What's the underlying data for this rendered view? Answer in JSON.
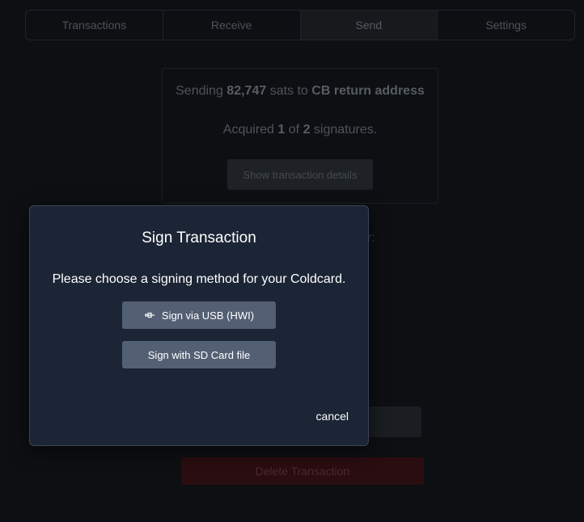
{
  "tabs": [
    {
      "label": "Transactions"
    },
    {
      "label": "Receive"
    },
    {
      "label": "Send"
    },
    {
      "label": "Settings"
    }
  ],
  "summary": {
    "sending_prefix": "Sending",
    "amount": "82,747",
    "sats_to": "sats to",
    "destination": "CB return address",
    "acquired_prefix": "Acquired",
    "acquired_count": "1",
    "of": "of",
    "required_count": "2",
    "signatures_suffix": "signatures.",
    "details_button": "Show transaction details"
  },
  "background": {
    "colon_fragment": "r:",
    "delete_button": "Delete Transaction"
  },
  "modal": {
    "title": "Sign Transaction",
    "description": "Please choose a signing method for your Coldcard.",
    "usb_button": "Sign via USB (HWI)",
    "usb_icon": "usb-icon",
    "sd_button": "Sign with SD Card file",
    "cancel": "cancel"
  },
  "colors": {
    "modal_bg": "#1b2535",
    "modal_button": "#536074",
    "delete_bg": "#2a0d10"
  }
}
